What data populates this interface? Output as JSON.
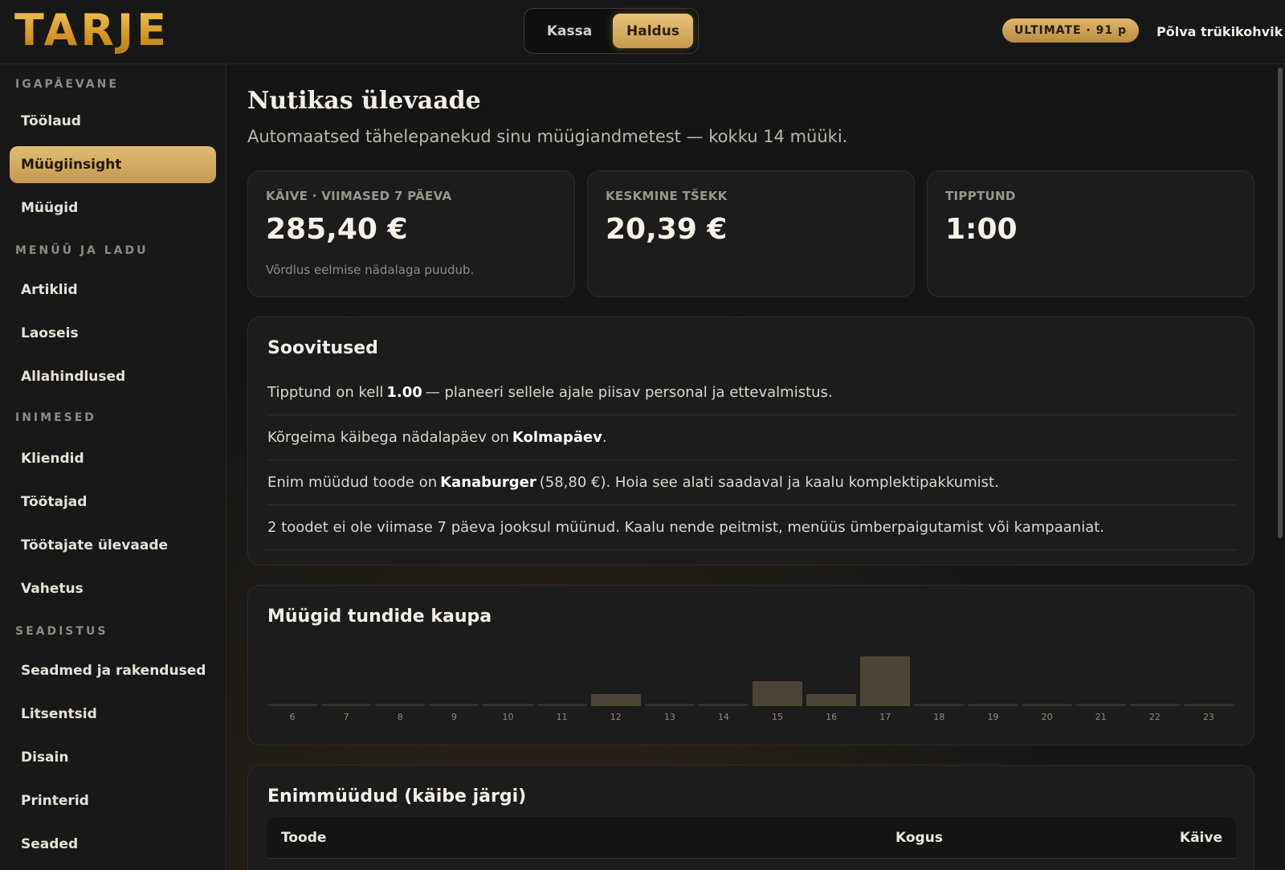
{
  "app": {
    "logo": "TARJE",
    "modes": [
      "Kassa",
      "Haldus"
    ],
    "active_mode": "Haldus",
    "plan_badge": "ULTIMATE · 91 p",
    "shop_name": "Põlva trükikohvik"
  },
  "sidebar": {
    "sections": [
      {
        "title": "IGAPÄEVANE",
        "items": [
          "Töölaud",
          "Müügiinsight",
          "Müügid"
        ]
      },
      {
        "title": "MENÜÜ JA LADU",
        "items": [
          "Artiklid",
          "Laoseis",
          "Allahindlused"
        ]
      },
      {
        "title": "INIMESED",
        "items": [
          "Kliendid",
          "Töötajad",
          "Töötajate ülevaade",
          "Vahetus"
        ]
      },
      {
        "title": "SEADISTUS",
        "items": [
          "Seadmed ja rakendused",
          "Litsentsid",
          "Disain",
          "Printerid",
          "Seaded"
        ]
      }
    ],
    "active_item": "Müügiinsight"
  },
  "main": {
    "title": "Nutikas ülevaade",
    "subtitle": "Automaatsed tähelepanekud sinu müügiandmetest — kokku 14 müüki.",
    "kpis": [
      {
        "label": "KÄIVE · VIIMASED 7 PÄEVA",
        "value": "285,40 €",
        "note": "Võrdlus eelmise nädalaga puudub."
      },
      {
        "label": "KESKMINE TŠEKK",
        "value": "20,39 €",
        "note": ""
      },
      {
        "label": "TIPPTUND",
        "value": "1:00",
        "note": ""
      }
    ],
    "recommendations": {
      "title": "Soovitused",
      "rows": [
        {
          "before": "Tipptund on kell ",
          "bold": "1.00",
          "after": " — planeeri sellele ajale piisav personal ja ettevalmistus."
        },
        {
          "before": "Kõrgeima käibega nädalapäev on ",
          "bold": "Kolmapäev",
          "after": "."
        },
        {
          "before": "Enim müüdud toode on ",
          "bold": "Kanaburger",
          "after": " (58,80 €). Hoia see alati saadaval ja kaalu komplektipakkumist."
        },
        {
          "before": "2 toodet ei ole viimase 7 päeva jooksul müünud. Kaalu nende peitmist, menüüs ümberpaigutamist või kampaaniat.",
          "bold": "",
          "after": ""
        }
      ]
    },
    "hourly": {
      "title": "Müügid tundide kaupa"
    },
    "top_sellers": {
      "title": "Enimmüüdud (käibe järgi)",
      "columns": [
        "Toode",
        "Kogus",
        "Käive"
      ]
    }
  },
  "chart_data": {
    "type": "bar",
    "title": "Müügid tundide kaupa",
    "categories": [
      "6",
      "7",
      "8",
      "9",
      "10",
      "11",
      "12",
      "13",
      "14",
      "15",
      "16",
      "17",
      "18",
      "19",
      "20",
      "21",
      "22",
      "23"
    ],
    "values": [
      0,
      0,
      0,
      0,
      0,
      0,
      1,
      0,
      0,
      2,
      1,
      4,
      0,
      0,
      0,
      0,
      0,
      0
    ],
    "xlabel": "",
    "ylabel": "",
    "ylim": [
      0,
      4
    ],
    "grid": false
  }
}
